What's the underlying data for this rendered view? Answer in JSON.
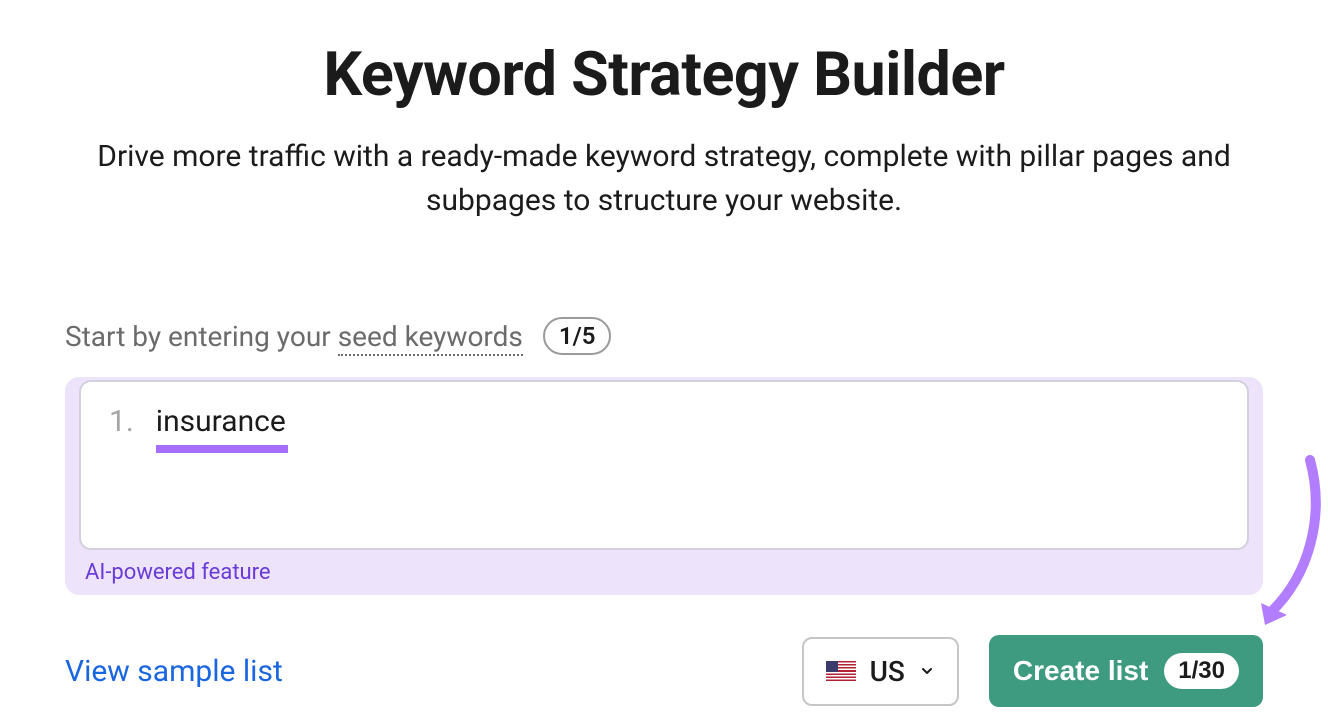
{
  "header": {
    "title": "Keyword Strategy Builder",
    "subtitle": "Drive more traffic with a ready-made keyword strategy, complete with pillar pages and subpages to structure your website."
  },
  "instruction": {
    "prefix": "Start by entering your ",
    "term": "seed keywords",
    "counter": "1/5"
  },
  "keywords": {
    "items": [
      {
        "num": "1.",
        "text": "insurance"
      }
    ],
    "ai_label": "AI-powered feature"
  },
  "footer": {
    "sample_link": "View sample list",
    "country": {
      "code": "US"
    },
    "create": {
      "label": "Create list",
      "counter": "1/30"
    }
  },
  "colors": {
    "accent_purple": "#a56eff",
    "panel_purple": "#ede3fb",
    "link_blue": "#1a66e0",
    "button_green": "#3f9b80"
  }
}
